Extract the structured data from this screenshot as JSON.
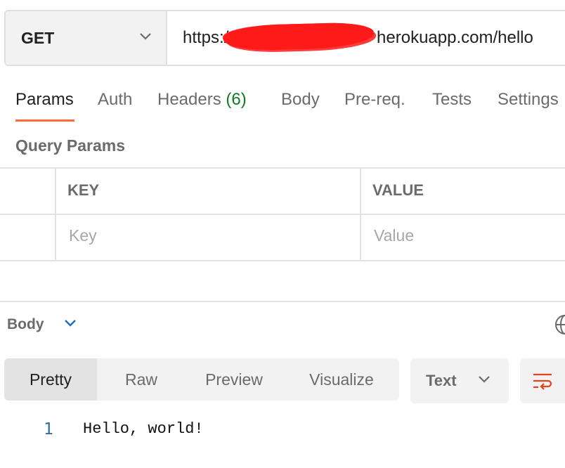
{
  "request": {
    "method": "GET",
    "url_prefix": "https://",
    "url_suffix": "herokuapp.com/hello"
  },
  "tabs": [
    {
      "label": "Params"
    },
    {
      "label": "Auth"
    },
    {
      "label": "Headers",
      "count": "(6)"
    },
    {
      "label": "Body"
    },
    {
      "label": "Pre-req."
    },
    {
      "label": "Tests"
    },
    {
      "label": "Settings"
    }
  ],
  "params": {
    "title": "Query Params",
    "columns": {
      "key": "KEY",
      "value": "VALUE"
    },
    "row_placeholder": {
      "key": "Key",
      "value": "Value"
    }
  },
  "response": {
    "body_label": "Body",
    "views": [
      "Pretty",
      "Raw",
      "Preview",
      "Visualize"
    ],
    "format": "Text",
    "lines": [
      {
        "number": "1",
        "text": "Hello, world!"
      }
    ]
  },
  "colors": {
    "accent": "#ff6c37",
    "count": "#0b7f1d",
    "line_number": "#2f6da8"
  },
  "icons": {
    "method_dropdown": "chevron-down-icon",
    "body_dropdown": "chevron-down-icon",
    "globe": "globe-icon",
    "wrap": "wrap-lines-icon"
  }
}
